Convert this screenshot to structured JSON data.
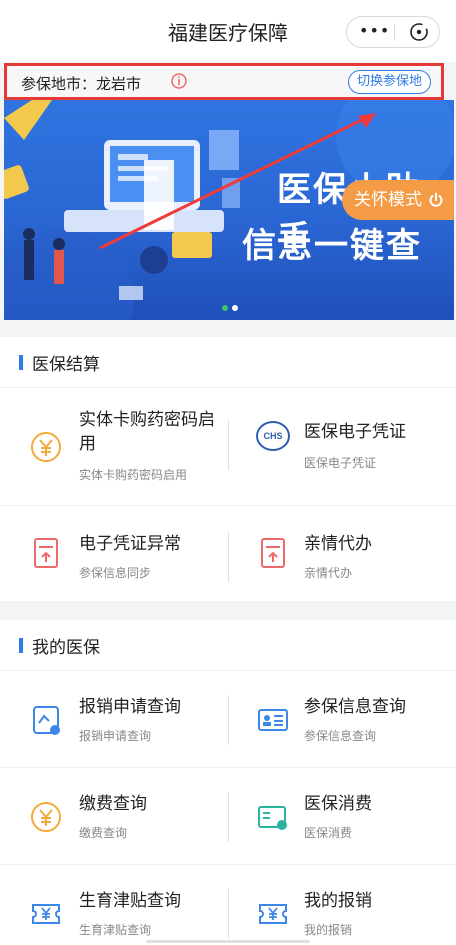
{
  "header": {
    "title": "福建医疗保障"
  },
  "region": {
    "label": "参保地市：龙岩市",
    "switch_label": "切换参保地"
  },
  "banner": {
    "line1": "医保小助手",
    "line2": "信息一键查",
    "care_mode": "关怀模式"
  },
  "sections": [
    {
      "title": "医保结算",
      "rows": [
        [
          {
            "title": "实体卡购药密码启用",
            "sub": "实体卡购药密码启用",
            "icon": "yuan-coin-icon"
          },
          {
            "title": "医保电子凭证",
            "sub": "医保电子凭证",
            "icon": "chs-logo-icon",
            "logo_text": "CHS"
          }
        ],
        [
          {
            "title": "电子凭证异常",
            "sub": "参保信息同步",
            "icon": "document-upload-icon"
          },
          {
            "title": "亲情代办",
            "sub": "亲情代办",
            "icon": "document-upload-icon"
          }
        ]
      ]
    },
    {
      "title": "我的医保",
      "rows": [
        [
          {
            "title": "报销申请查询",
            "sub": "报销申请查询",
            "icon": "claim-search-icon"
          },
          {
            "title": "参保信息查询",
            "sub": "参保信息查询",
            "icon": "id-card-icon"
          }
        ],
        [
          {
            "title": "缴费查询",
            "sub": "缴费查询",
            "icon": "yuan-coin-icon"
          },
          {
            "title": "医保消费",
            "sub": "医保消费",
            "icon": "card-consume-icon"
          }
        ],
        [
          {
            "title": "生育津贴查询",
            "sub": "生育津贴查询",
            "icon": "yuan-ticket-icon"
          },
          {
            "title": "我的报销",
            "sub": "我的报销",
            "icon": "yuan-ticket-icon"
          }
        ]
      ]
    }
  ],
  "colors": {
    "accent": "#2d7be5",
    "care": "#f39b45",
    "highlight_border": "#e53935",
    "icon_orange": "#f3a93b",
    "icon_red": "#ee6a6a",
    "icon_blue": "#3d87e6"
  }
}
